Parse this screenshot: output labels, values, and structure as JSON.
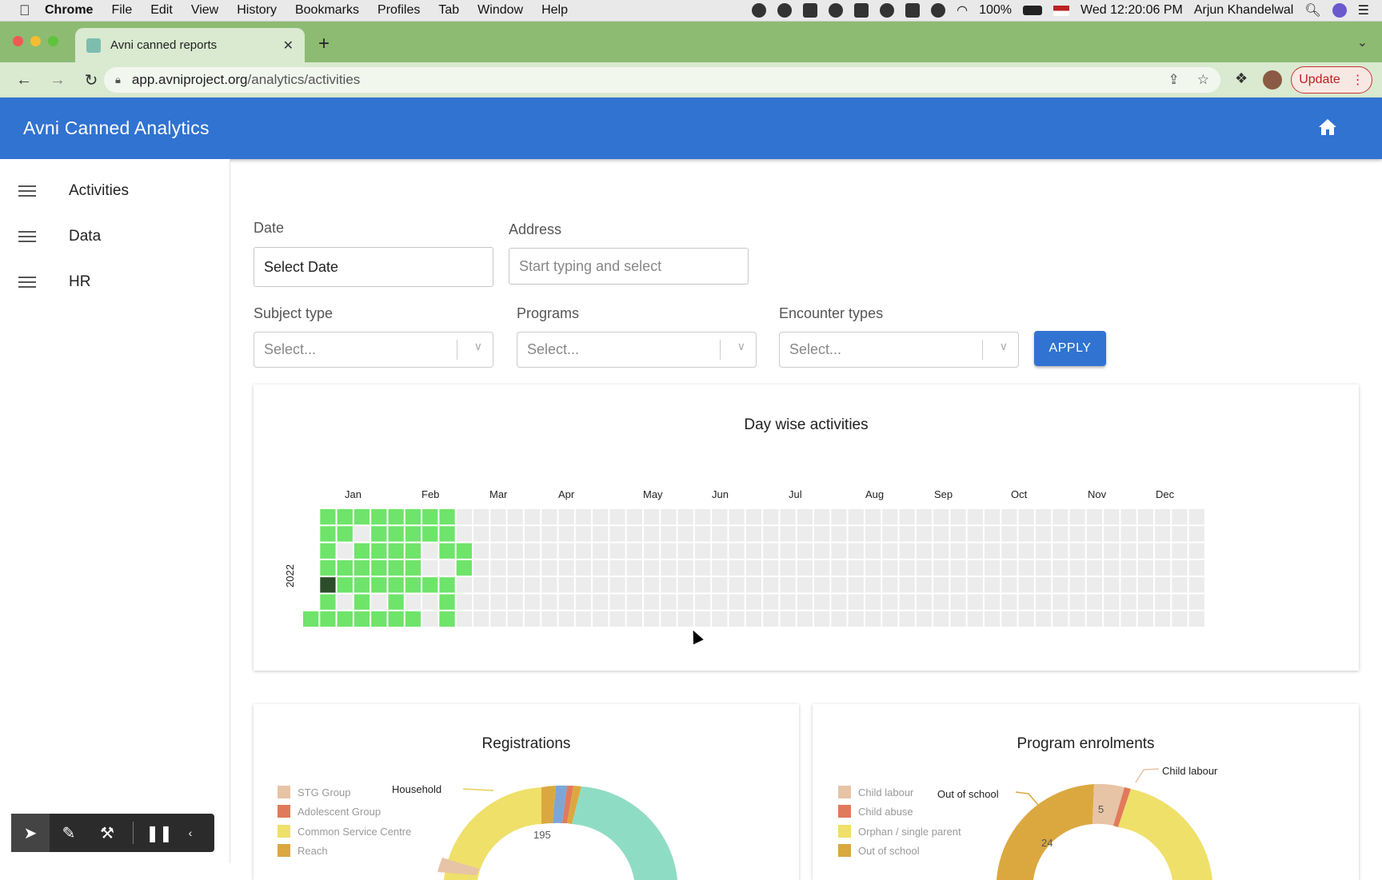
{
  "menubar": {
    "app": "Chrome",
    "items": [
      "File",
      "Edit",
      "View",
      "History",
      "Bookmarks",
      "Profiles",
      "Tab",
      "Window",
      "Help"
    ],
    "battery": "100%",
    "clock": "Wed 12:20:06 PM",
    "user": "Arjun Khandelwal"
  },
  "browser": {
    "tab_title": "Avni canned reports",
    "url_host": "app.avniproject.org",
    "url_path": "/analytics/activities",
    "update_label": "Update"
  },
  "app": {
    "title": "Avni Canned Analytics",
    "sidebar": [
      "Activities",
      "Data",
      "HR"
    ]
  },
  "filters": {
    "date_label": "Date",
    "date_value": "Select Date",
    "address_label": "Address",
    "address_placeholder": "Start typing and select",
    "subject_label": "Subject type",
    "programs_label": "Programs",
    "encounter_label": "Encounter types",
    "select_placeholder": "Select...",
    "apply": "APPLY"
  },
  "chart_data": [
    {
      "type": "heatmap",
      "title": "Day wise activities",
      "year": "2022",
      "months": [
        "Jan",
        "Feb",
        "Mar",
        "Apr",
        "May",
        "Jun",
        "Jul",
        "Aug",
        "Sep",
        "Oct",
        "Nov",
        "Dec"
      ],
      "active_days_through": "Mar",
      "colors": {
        "active": "#6ee46a",
        "peak": "#2c4d2a",
        "empty": "#ececec"
      }
    },
    {
      "type": "pie",
      "title": "Registrations",
      "legend": [
        "STG Group",
        "Adolescent Group",
        "Common Service Centre",
        "Reach"
      ],
      "labels": [
        "Household"
      ],
      "visible_value": 195
    },
    {
      "type": "pie",
      "title": "Program enrolments",
      "legend": [
        "Child labour",
        "Child abuse",
        "Orphan / single parent",
        "Out of school"
      ],
      "labels": [
        "Out of school",
        "Child labour"
      ],
      "visible_values": [
        24,
        5
      ]
    }
  ],
  "colors": {
    "appbar": "#3173d0",
    "tabbar": "#8dbb72"
  }
}
